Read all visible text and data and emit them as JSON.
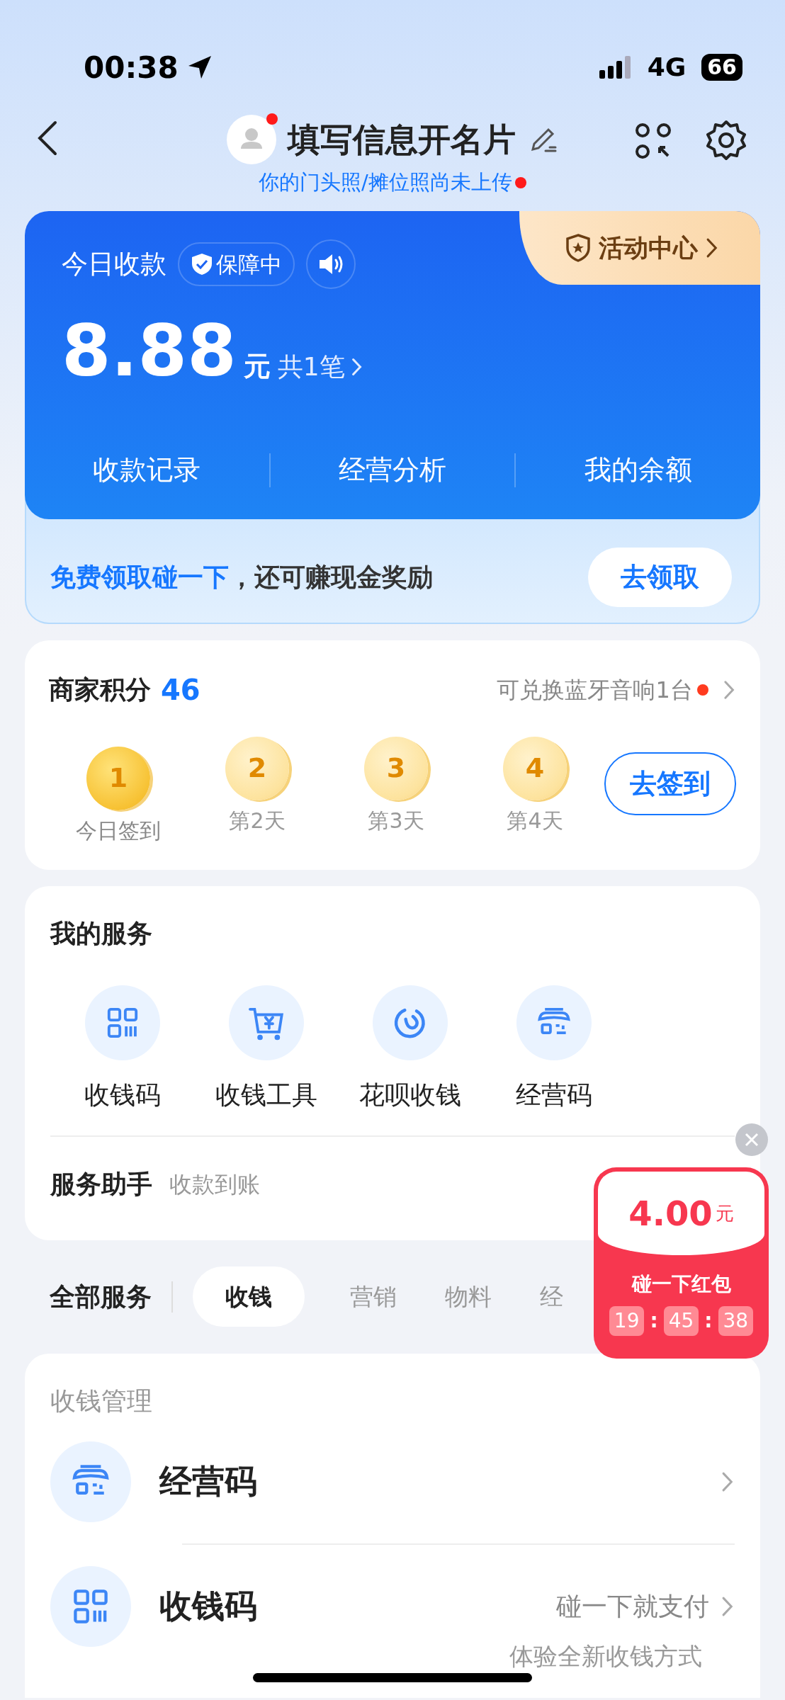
{
  "status_bar": {
    "time": "00:38",
    "network": "4G",
    "battery": "66"
  },
  "header": {
    "title": "填写信息开名片",
    "subtitle": "你的门头照/摊位照尚未上传",
    "avatar_notice": true,
    "subtitle_notice": true
  },
  "income_card": {
    "label": "今日收款",
    "badge": "保障中",
    "activity": "活动中心",
    "amount": "8.88",
    "unit": "元",
    "count": "共1笔",
    "links": [
      "收款记录",
      "经营分析",
      "我的余额"
    ]
  },
  "promo": {
    "highlight": "免费领取碰一下",
    "text": "，还可赚现金奖励",
    "button": "去领取"
  },
  "points": {
    "title": "商家积分",
    "value": "46",
    "exchange": "可兑换蓝牙音响1台",
    "exchange_notice": true,
    "button": "去签到",
    "days": [
      {
        "number": "1",
        "label": "今日签到",
        "today": true
      },
      {
        "number": "2",
        "label": "第2天",
        "today": false
      },
      {
        "number": "3",
        "label": "第3天",
        "today": false
      },
      {
        "number": "4",
        "label": "第4天",
        "today": false
      }
    ]
  },
  "my_services": {
    "title": "我的服务",
    "items": [
      {
        "label": "收钱码",
        "kind": "qr"
      },
      {
        "label": "收钱工具",
        "kind": "cart"
      },
      {
        "label": "花呗收钱",
        "kind": "swirl"
      },
      {
        "label": "经营码",
        "kind": "store"
      }
    ],
    "assistant_title": "服务助手",
    "assistant_text": "收款到账"
  },
  "all_services": {
    "title": "全部服务",
    "tabs": [
      {
        "label": "收钱",
        "selected": true
      },
      {
        "label": "营销",
        "selected": false
      },
      {
        "label": "物料",
        "selected": false
      },
      {
        "label": "经",
        "selected": false
      }
    ]
  },
  "collect_management": {
    "title": "收钱管理",
    "rows": [
      {
        "label": "经营码",
        "kind": "store"
      },
      {
        "label": "收钱码",
        "kind": "qr",
        "note": "碰一下就支付",
        "subnote": "体验全新收钱方式"
      }
    ]
  },
  "red_packet": {
    "amount": "4.00",
    "unit": "元",
    "label": "碰一下红包",
    "countdown": [
      "19",
      "45",
      "38"
    ],
    "separator": ":"
  }
}
